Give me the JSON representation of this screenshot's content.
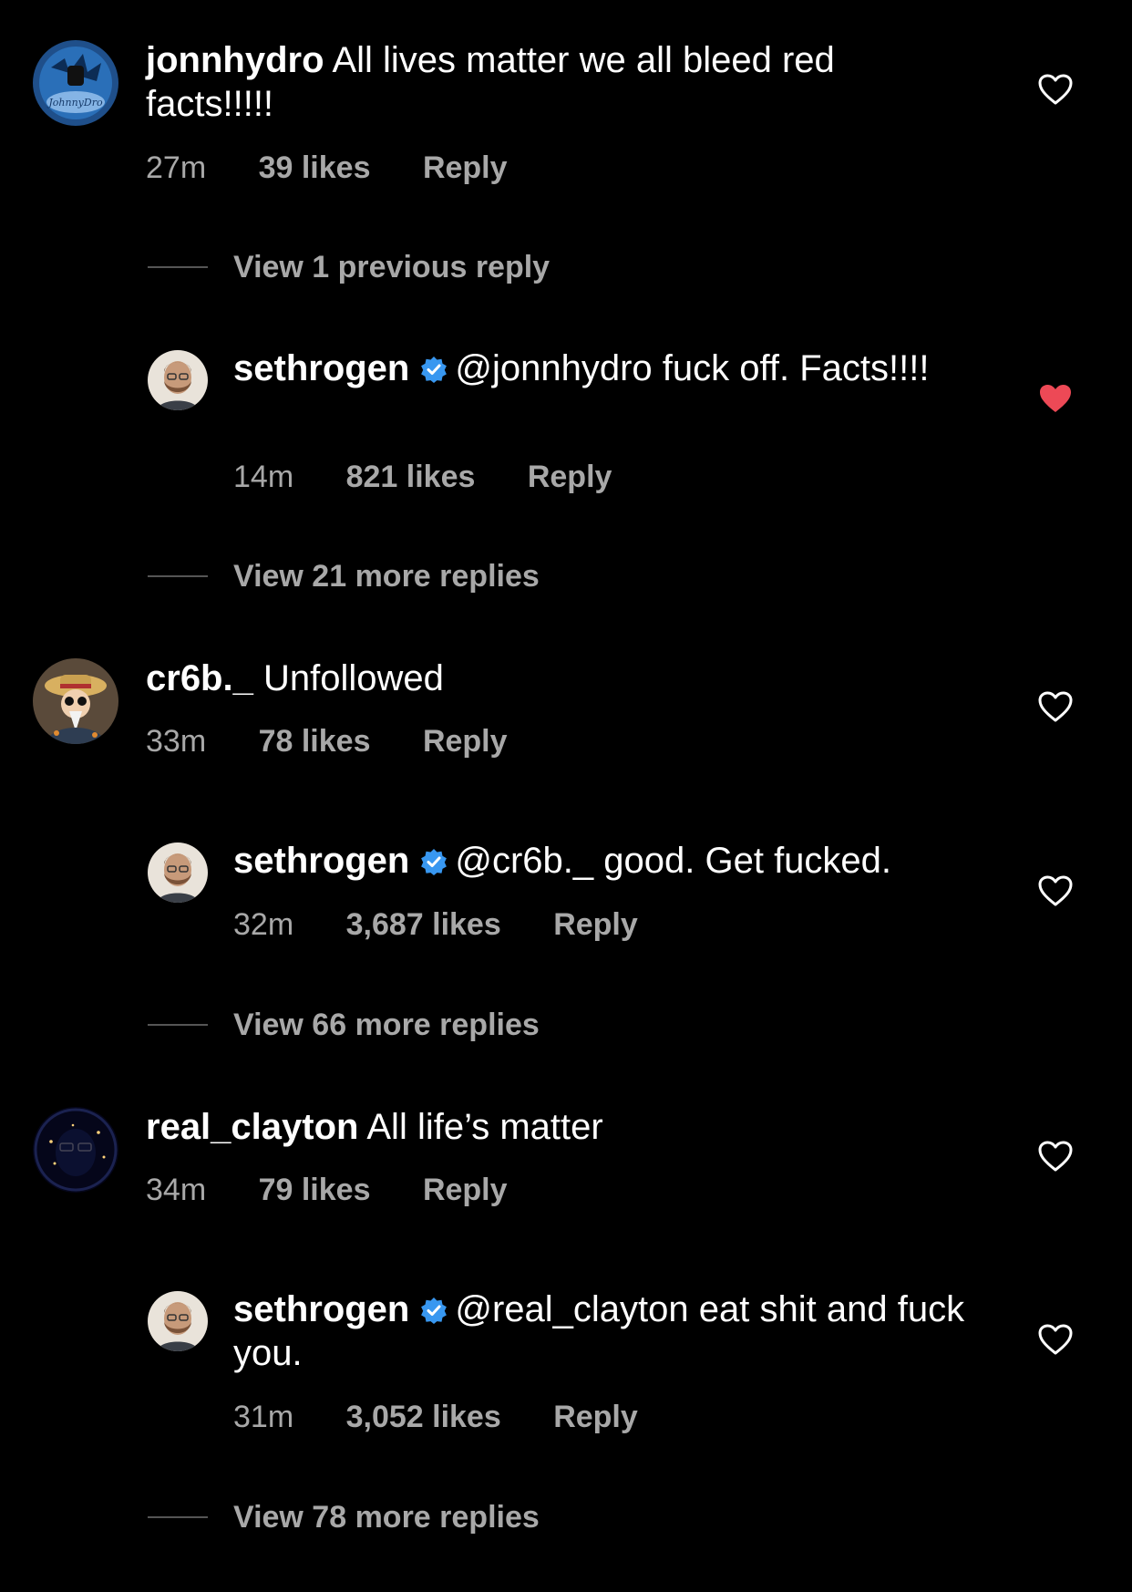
{
  "accent": {
    "verified": "#3897f0",
    "liked": "#ed4956"
  },
  "comments": [
    {
      "username": "jonnhydro",
      "text": "All lives matter we all bleed red facts!!!!!",
      "time": "27m",
      "likes": "39 likes",
      "reply": "Reply",
      "liked": false,
      "view_link": "View 1 previous reply",
      "reply_item": {
        "username": "sethrogen",
        "mention": "@jonnhydro",
        "text": "fuck off. Facts!!!!",
        "time": "14m",
        "likes": "821 likes",
        "reply": "Reply",
        "liked": true
      },
      "after_link": "View 21 more replies"
    },
    {
      "username": "cr6b._",
      "text": "Unfollowed",
      "time": "33m",
      "likes": "78 likes",
      "reply": "Reply",
      "liked": false,
      "reply_item": {
        "username": "sethrogen",
        "mention": "@cr6b._",
        "text": "good. Get fucked.",
        "time": "32m",
        "likes": "3,687 likes",
        "reply": "Reply",
        "liked": false
      },
      "after_link": "View 66 more replies"
    },
    {
      "username": "real_clayton",
      "text": "All life’s matter",
      "time": "34m",
      "likes": "79 likes",
      "reply": "Reply",
      "liked": false,
      "reply_item": {
        "username": "sethrogen",
        "mention": "@real_clayton",
        "text": "eat shit and fuck you.",
        "time": "31m",
        "likes": "3,052 likes",
        "reply": "Reply",
        "liked": false
      },
      "after_link": "View 78 more replies"
    }
  ]
}
